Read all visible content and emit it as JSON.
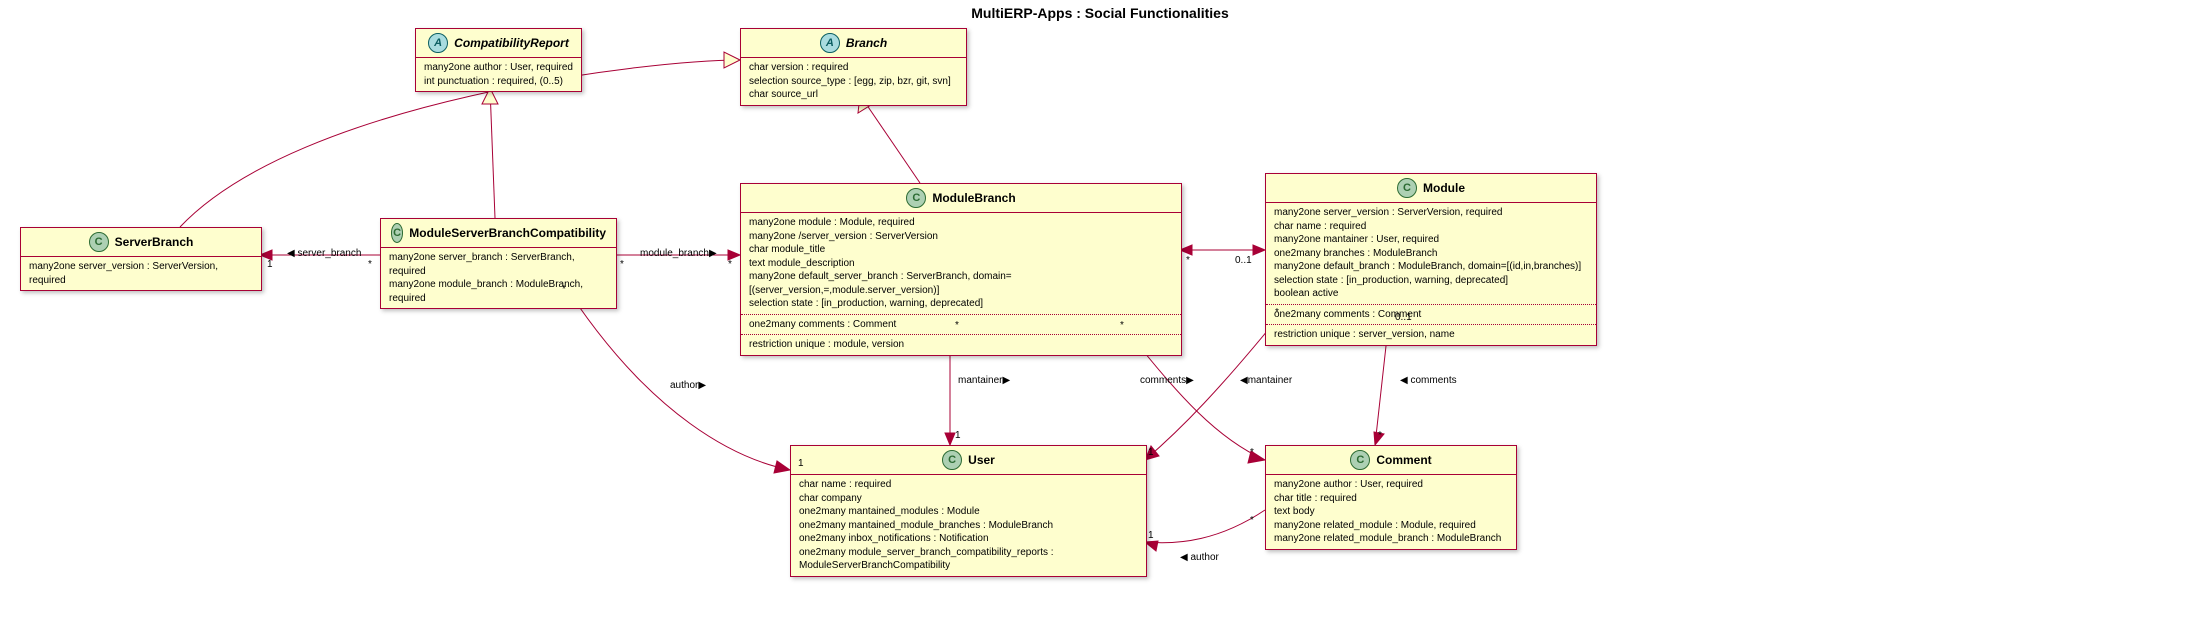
{
  "title": "MultiERP-Apps : Social Functionalities",
  "classes": {
    "CompatibilityReport": {
      "stereotype": "A",
      "abstract": true,
      "name": "CompatibilityReport",
      "attrs": [
        "many2one author : User, required",
        "int punctuation : required, (0..5)"
      ]
    },
    "Branch": {
      "stereotype": "A",
      "abstract": true,
      "name": "Branch",
      "attrs": [
        "char version : required",
        "selection source_type : [egg, zip, bzr, git, svn]",
        "char source_url"
      ]
    },
    "ServerBranch": {
      "stereotype": "C",
      "name": "ServerBranch",
      "attrs": [
        "many2one server_version : ServerVersion, required"
      ]
    },
    "ModuleServerBranchCompatibility": {
      "stereotype": "C",
      "name": "ModuleServerBranchCompatibility",
      "attrs": [
        "many2one server_branch : ServerBranch, required",
        "many2one module_branch : ModuleBranch, required"
      ]
    },
    "ModuleBranch": {
      "stereotype": "C",
      "name": "ModuleBranch",
      "attrs": [
        "many2one module : Module, required",
        "many2one /server_version : ServerVersion",
        "char module_title",
        "text module_description",
        "many2one default_server_branch : ServerBranch, domain=[(server_version,=,module.server_version)]",
        "selection state : [in_production, warning, deprecated]"
      ],
      "extra": [
        [
          "one2many comments : Comment"
        ],
        [
          "restriction unique : module, version"
        ]
      ]
    },
    "Module": {
      "stereotype": "C",
      "name": "Module",
      "attrs": [
        "many2one server_version : ServerVersion, required",
        "char name : required",
        "many2one mantainer : User, required",
        "one2many branches : ModuleBranch",
        "many2one default_branch : ModuleBranch, domain=[(id,in,branches)]",
        "selection state : [in_production, warning, deprecated]",
        "boolean active"
      ],
      "extra": [
        [
          "one2many comments : Comment"
        ],
        [
          "restriction unique : server_version, name"
        ]
      ]
    },
    "User": {
      "stereotype": "C",
      "name": "User",
      "attrs": [
        "char name : required",
        "char company",
        "one2many mantained_modules : Module",
        "one2many mantained_module_branches : ModuleBranch",
        "one2many inbox_notifications : Notification",
        "one2many module_server_branch_compatibility_reports : ModuleServerBranchCompatibility"
      ]
    },
    "Comment": {
      "stereotype": "C",
      "name": "Comment",
      "attrs": [
        "many2one author : User, required",
        "char title : required",
        "text body",
        "many2one related_module : Module, required",
        "many2one related_module_branch : ModuleBranch"
      ]
    }
  },
  "chart_data": {
    "type": "uml-class-diagram",
    "title": "MultiERP-Apps : Social Functionalities",
    "classes": [
      {
        "name": "CompatibilityReport",
        "abstract": true,
        "attributes": [
          "many2one author : User, required",
          "int punctuation : required, (0..5)"
        ]
      },
      {
        "name": "Branch",
        "abstract": true,
        "attributes": [
          "char version : required",
          "selection source_type : [egg, zip, bzr, git, svn]",
          "char source_url"
        ]
      },
      {
        "name": "ServerBranch",
        "abstract": false,
        "attributes": [
          "many2one server_version : ServerVersion, required"
        ]
      },
      {
        "name": "ModuleServerBranchCompatibility",
        "abstract": false,
        "attributes": [
          "many2one server_branch : ServerBranch, required",
          "many2one module_branch : ModuleBranch, required"
        ]
      },
      {
        "name": "ModuleBranch",
        "abstract": false,
        "attributes": [
          "many2one module : Module, required",
          "many2one /server_version : ServerVersion",
          "char module_title",
          "text module_description",
          "many2one default_server_branch : ServerBranch, domain=[(server_version,=,module.server_version)]",
          "selection state : [in_production, warning, deprecated]",
          "one2many comments : Comment",
          "restriction unique : module, version"
        ]
      },
      {
        "name": "Module",
        "abstract": false,
        "attributes": [
          "many2one server_version : ServerVersion, required",
          "char name : required",
          "many2one mantainer : User, required",
          "one2many branches : ModuleBranch",
          "many2one default_branch : ModuleBranch, domain=[(id,in,branches)]",
          "selection state : [in_production, warning, deprecated]",
          "boolean active",
          "one2many comments : Comment",
          "restriction unique : server_version, name"
        ]
      },
      {
        "name": "User",
        "abstract": false,
        "attributes": [
          "char name : required",
          "char company",
          "one2many mantained_modules : Module",
          "one2many mantained_module_branches : ModuleBranch",
          "one2many inbox_notifications : Notification",
          "one2many module_server_branch_compatibility_reports : ModuleServerBranchCompatibility"
        ]
      },
      {
        "name": "Comment",
        "abstract": false,
        "attributes": [
          "many2one author : User, required",
          "char title : required",
          "text body",
          "many2one related_module : Module, required",
          "many2one related_module_branch : ModuleBranch"
        ]
      }
    ],
    "relations": [
      {
        "type": "generalization",
        "from": "ServerBranch",
        "to": "Branch"
      },
      {
        "type": "generalization",
        "from": "ModuleBranch",
        "to": "Branch"
      },
      {
        "type": "generalization",
        "from": "ModuleServerBranchCompatibility",
        "to": "CompatibilityReport"
      },
      {
        "type": "association",
        "from": "ModuleServerBranchCompatibility",
        "to": "ServerBranch",
        "label": "server_branch",
        "from_mult": "*",
        "to_mult": "1",
        "arrow": "to"
      },
      {
        "type": "association",
        "from": "ModuleServerBranchCompatibility",
        "to": "ModuleBranch",
        "label": "module_branch",
        "from_mult": "*",
        "to_mult": "*",
        "arrow": "to"
      },
      {
        "type": "association",
        "from": "ModuleServerBranchCompatibility",
        "to": "User",
        "label": "author",
        "from_mult": "*",
        "to_mult": "1",
        "arrow": "to"
      },
      {
        "type": "association",
        "from": "ModuleBranch",
        "to": "User",
        "label": "mantainer",
        "from_mult": "*",
        "to_mult": "1",
        "arrow": "both"
      },
      {
        "type": "association",
        "from": "ModuleBranch",
        "to": "Module",
        "from_mult": "*",
        "to_mult": "0..1",
        "arrow": "both"
      },
      {
        "type": "association",
        "from": "ModuleBranch",
        "to": "Comment",
        "label": "comments",
        "from_mult": "*",
        "to_mult": "*",
        "arrow": "to"
      },
      {
        "type": "association",
        "from": "Module",
        "to": "User",
        "label": "mantainer",
        "from_mult": "*",
        "to_mult": "1",
        "arrow": "to"
      },
      {
        "type": "association",
        "from": "Module",
        "to": "Comment",
        "label": "comments",
        "from_mult": "0..1",
        "to_mult": "*",
        "arrow": "to"
      },
      {
        "type": "association",
        "from": "Comment",
        "to": "User",
        "label": "author",
        "from_mult": "*",
        "to_mult": "1",
        "arrow": "to"
      }
    ]
  },
  "labels": {
    "server_branch": "server_branch",
    "module_branch": "module_branch",
    "author": "author",
    "mantainer": "mantainer",
    "comments": "comments",
    "m1": "1",
    "mstar": "*",
    "m01": "0..1",
    "tri_l": "◀",
    "tri_r": "▶"
  }
}
